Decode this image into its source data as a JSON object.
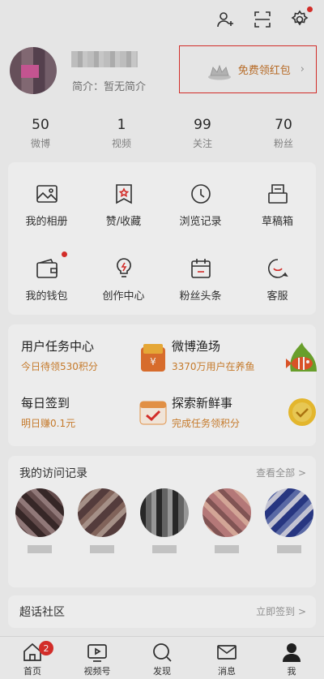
{
  "profile": {
    "intro": "简介：暂无简介",
    "red_packet": "免费领红包"
  },
  "stats": [
    {
      "num": "50",
      "label": "微博"
    },
    {
      "num": "1",
      "label": "视频"
    },
    {
      "num": "99",
      "label": "关注"
    },
    {
      "num": "70",
      "label": "粉丝"
    }
  ],
  "grid": [
    {
      "label": "我的相册",
      "icon": "photo-icon"
    },
    {
      "label": "赞/收藏",
      "icon": "like-collect-icon"
    },
    {
      "label": "浏览记录",
      "icon": "history-icon"
    },
    {
      "label": "草稿箱",
      "icon": "draft-icon"
    },
    {
      "label": "我的钱包",
      "icon": "wallet-icon"
    },
    {
      "label": "创作中心",
      "icon": "bulb-icon"
    },
    {
      "label": "粉丝头条",
      "icon": "calendar-icon"
    },
    {
      "label": "客服",
      "icon": "service-icon"
    }
  ],
  "tasks": [
    {
      "title": "用户任务中心",
      "sub": "今日待领530积分"
    },
    {
      "title": "微博渔场",
      "sub": "3370万用户在养鱼"
    },
    {
      "title": "每日签到",
      "sub": "明日赚0.1元"
    },
    {
      "title": "探索新鲜事",
      "sub": "完成任务领积分"
    }
  ],
  "visits": {
    "title": "我的访问记录",
    "all": "查看全部 >"
  },
  "topic": {
    "title": "超话社区",
    "sign": "立即签到 >"
  },
  "tabs": [
    {
      "label": "首页",
      "badge": "2"
    },
    {
      "label": "视频号"
    },
    {
      "label": "发现"
    },
    {
      "label": "消息"
    },
    {
      "label": "我"
    }
  ]
}
